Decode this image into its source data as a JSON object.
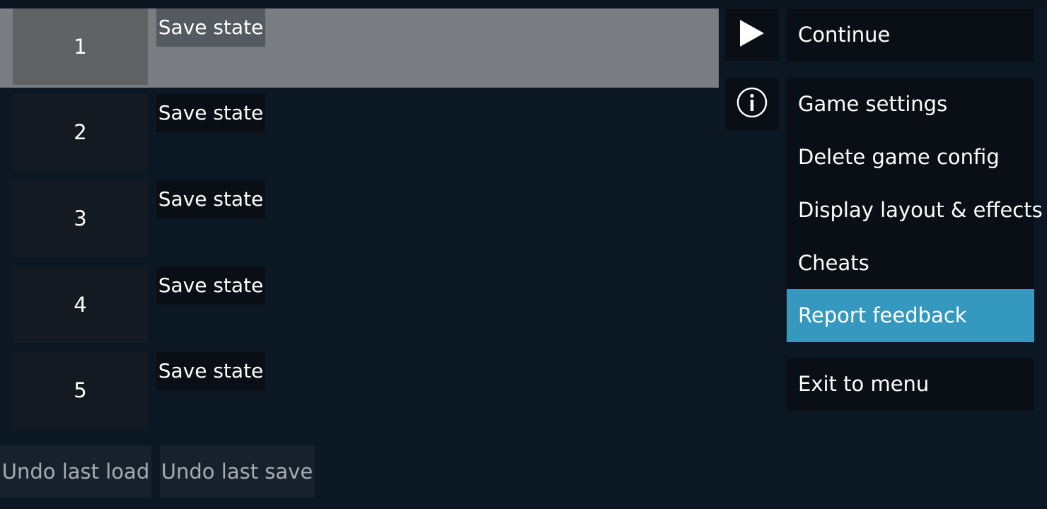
{
  "save_slots": [
    {
      "number": "1",
      "button_label": "Save state"
    },
    {
      "number": "2",
      "button_label": "Save state"
    },
    {
      "number": "3",
      "button_label": "Save state"
    },
    {
      "number": "4",
      "button_label": "Save state"
    },
    {
      "number": "5",
      "button_label": "Save state"
    }
  ],
  "undo": {
    "load_label": "Undo last load",
    "save_label": "Undo last save"
  },
  "menu": {
    "continue_label": "Continue",
    "items": [
      {
        "label": "Game settings"
      },
      {
        "label": "Delete game config"
      },
      {
        "label": "Display layout & effects"
      },
      {
        "label": "Cheats"
      },
      {
        "label": "Report feedback"
      }
    ],
    "exit_label": "Exit to menu"
  },
  "icons": {
    "play": "play-icon",
    "info": "info-icon"
  },
  "colors": {
    "background": "#0c1724",
    "selected_slot": "#7a7d81",
    "highlight": "#3598be",
    "panel": "#0a0f16"
  }
}
